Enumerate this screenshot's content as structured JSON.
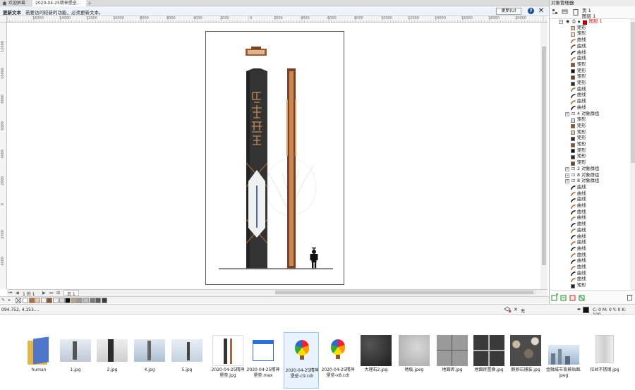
{
  "tabs": [
    {
      "label": "欢迎屏幕"
    },
    {
      "label": "2020-04-25精神堡垒..."
    }
  ],
  "update_bar": {
    "title": "更新文本",
    "message": "若要访问较新的功能，必须更新文本。",
    "button": "更新(U)",
    "help": "?",
    "close": "✕"
  },
  "hruler": [
    "16000",
    "14000",
    "12000",
    "10000",
    "8000",
    "6000",
    "4000",
    "2000",
    "0",
    "2000",
    "4000",
    "6000",
    "8000",
    "10000",
    "12000",
    "14000",
    "16000",
    "18000",
    "20000"
  ],
  "vruler": [
    "12000",
    "10000",
    "8000",
    "6000",
    "4000",
    "2000",
    "0",
    "2000",
    "4000"
  ],
  "page_nav": {
    "page_of": "1 的 1",
    "page_tab": "页 1"
  },
  "palette": {
    "colors": [
      "#ffffff",
      "#b26d3a",
      "#e8c9a8",
      "#f5efe6",
      "#8a5530",
      "#efefef",
      "#d9d9d9",
      "#111111",
      "#bfa282",
      "#9a9a9a",
      "#c0c0c0",
      "#7a7a7a",
      "#5b5b5b",
      "#3a3a3a"
    ]
  },
  "status": {
    "coords": "094.752, 4,153....",
    "fill_label": "无",
    "cmyk": "C: 0 M: 0 Y: 0 K: 100"
  },
  "object_manager": {
    "title": "对象管理器",
    "page": "页 1",
    "layer": "图层 1",
    "layer_name": "图层 1",
    "items": [
      {
        "label": "矩形",
        "kind": "rect",
        "color": "#e8c9a8",
        "level": 2
      },
      {
        "label": "矩形",
        "kind": "rect",
        "color": "#f2e2cf",
        "level": 2
      },
      {
        "label": "曲线",
        "kind": "curve",
        "color": "#b26d3a",
        "level": 2
      },
      {
        "label": "曲线",
        "kind": "curve",
        "color": "#7a4a2a",
        "level": 2
      },
      {
        "label": "曲线",
        "kind": "curve",
        "color": "#222222",
        "level": 2
      },
      {
        "label": "曲线",
        "kind": "curve",
        "color": "#b26d3a",
        "level": 2
      },
      {
        "label": "矩形",
        "kind": "rect",
        "color": "#8a5530",
        "level": 2
      },
      {
        "label": "矩形",
        "kind": "rect",
        "color": "#111111",
        "level": 2
      },
      {
        "label": "矩形",
        "kind": "rect",
        "color": "#6b4024",
        "level": 2
      },
      {
        "label": "矩形",
        "kind": "rect",
        "color": "#2a2a2a",
        "level": 2
      },
      {
        "label": "曲线",
        "kind": "curve",
        "color": "#b26d3a",
        "level": 2
      },
      {
        "label": "曲线",
        "kind": "curve",
        "color": "#333333",
        "level": 2
      },
      {
        "label": "曲线",
        "kind": "curve",
        "color": "#b26d3a",
        "level": 2
      },
      {
        "label": "曲线",
        "kind": "curve",
        "color": "#222222",
        "level": 2
      },
      {
        "label": "4 对象群组",
        "kind": "group",
        "color": "",
        "level": 1
      },
      {
        "label": "矩形",
        "kind": "rect",
        "color": "#dcdcdc",
        "level": 2
      },
      {
        "label": "矩形",
        "kind": "rect",
        "color": "#8a5530",
        "level": 2
      },
      {
        "label": "矩形",
        "kind": "rect",
        "color": "#e8c9a8",
        "level": 2
      },
      {
        "label": "矩形",
        "kind": "rect",
        "color": "#2a2a2a",
        "level": 2
      },
      {
        "label": "矩形",
        "kind": "rect",
        "color": "#8a5530",
        "level": 2
      },
      {
        "label": "矩形",
        "kind": "rect",
        "color": "#111111",
        "level": 2
      },
      {
        "label": "矩形",
        "kind": "rect",
        "color": "#2a2a2a",
        "level": 2
      },
      {
        "label": "矩形",
        "kind": "rect",
        "color": "#6b4024",
        "level": 2
      },
      {
        "label": "2 对象群组",
        "kind": "group",
        "color": "",
        "level": 1
      },
      {
        "label": "8 对象群组",
        "kind": "group",
        "color": "",
        "level": 1
      },
      {
        "label": "8 对象群组",
        "kind": "group",
        "color": "",
        "level": 1
      },
      {
        "label": "曲线",
        "kind": "curve",
        "color": "#222222",
        "level": 2
      },
      {
        "label": "曲线",
        "kind": "curve",
        "color": "#b26d3a",
        "level": 2
      },
      {
        "label": "曲线",
        "kind": "curve",
        "color": "#222222",
        "level": 2
      },
      {
        "label": "曲线",
        "kind": "curve",
        "color": "#b26d3a",
        "level": 2
      },
      {
        "label": "曲线",
        "kind": "curve",
        "color": "#222222",
        "level": 2
      },
      {
        "label": "曲线",
        "kind": "curve",
        "color": "#b26d3a",
        "level": 2
      },
      {
        "label": "曲线",
        "kind": "curve",
        "color": "#222222",
        "level": 2
      },
      {
        "label": "曲线",
        "kind": "curve",
        "color": "#b26d3a",
        "level": 2
      },
      {
        "label": "曲线",
        "kind": "curve",
        "color": "#222222",
        "level": 2
      },
      {
        "label": "曲线",
        "kind": "curve",
        "color": "#b26d3a",
        "level": 2
      },
      {
        "label": "曲线",
        "kind": "curve",
        "color": "#222222",
        "level": 2
      },
      {
        "label": "曲线",
        "kind": "curve",
        "color": "#b26d3a",
        "level": 2
      },
      {
        "label": "曲线",
        "kind": "curve",
        "color": "#222222",
        "level": 2
      },
      {
        "label": "曲线",
        "kind": "curve",
        "color": "#b26d3a",
        "level": 2
      },
      {
        "label": "曲线",
        "kind": "curve",
        "color": "#222222",
        "level": 2
      },
      {
        "label": "曲线",
        "kind": "curve",
        "color": "#b26d3a",
        "level": 2
      },
      {
        "label": "矩形",
        "kind": "rect",
        "color": "#222222",
        "level": 2
      }
    ]
  },
  "files": [
    {
      "name": "human",
      "type": "folder"
    },
    {
      "name": "1.jpg",
      "type": "img-sky"
    },
    {
      "name": "2.jpg",
      "type": "img-pillar"
    },
    {
      "name": "4.jpg",
      "type": "img-sky2"
    },
    {
      "name": "5.jpg",
      "type": "img-sky3"
    },
    {
      "name": "2020-04-25精神堡垒.jpg",
      "type": "img-tower"
    },
    {
      "name": "2020-04-25精神堡垒.max",
      "type": "max"
    },
    {
      "name": "2020-04-25精神堡垒-c9.cdr",
      "type": "cdr"
    },
    {
      "name": "2020-04-25精神堡垒-x8.cdr",
      "type": "cdr"
    },
    {
      "name": "大理石2.jpg",
      "type": "img-marble-dark"
    },
    {
      "name": "地板.jpeg",
      "type": "img-floor"
    },
    {
      "name": "地面砖.jpg",
      "type": "img-tile"
    },
    {
      "name": "地面砖置换.jpg",
      "type": "img-tile-dark"
    },
    {
      "name": "鹅卵石铺装.jpg",
      "type": "img-pebble"
    },
    {
      "name": "金融城市背景贴图.jpeg",
      "type": "img-city"
    },
    {
      "name": "拉丝不锈钢.jpg",
      "type": "img-steel"
    }
  ]
}
